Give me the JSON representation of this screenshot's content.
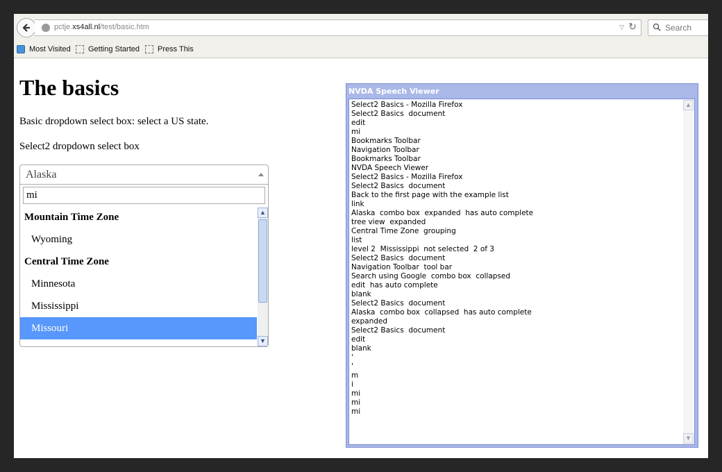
{
  "browser": {
    "url_prefix": "pctje.",
    "url_domain": "xs4all.nl",
    "url_path": "/test/basic.htm",
    "search_placeholder": "Search",
    "bookmarks": [
      "Most Visited",
      "Getting Started",
      "Press This"
    ]
  },
  "page": {
    "title": "The basics",
    "para1": "Basic dropdown select box: select a US state.",
    "para2": "Select2 dropdown select box"
  },
  "select2": {
    "selected_value": "Alaska",
    "search_value": "mi",
    "groups": [
      {
        "label": "Mountain Time Zone",
        "options": [
          "Wyoming"
        ]
      },
      {
        "label": "Central Time Zone",
        "options": [
          "Minnesota",
          "Mississippi",
          "Missouri"
        ]
      }
    ],
    "highlighted_option": "Missouri",
    "highlight_color": "#5897fb"
  },
  "nvda": {
    "title": "NVDA Speech Viewer",
    "lines": [
      "Select2 Basics - Mozilla Firefox",
      "Select2 Basics  document",
      "edit",
      "mi",
      "Bookmarks Toolbar",
      "Navigation Toolbar",
      "Bookmarks Toolbar",
      "NVDA Speech Viewer",
      "Select2 Basics - Mozilla Firefox",
      "Select2 Basics  document",
      "Back to the first page with the example list",
      "link",
      "Alaska  combo box  expanded  has auto complete",
      "tree view  expanded",
      "Central Time Zone  grouping",
      "list",
      "level 2  Mississippi  not selected  2 of 3",
      "Select2 Basics  document",
      "Navigation Toolbar  tool bar",
      "Search using Google  combo box  collapsed",
      "edit  has auto complete",
      "blank",
      "Select2 Basics  document",
      "Alaska  combo box  collapsed  has auto complete",
      "expanded",
      "Select2 Basics  document",
      "edit",
      "blank",
      "'",
      "'",
      "m",
      "i",
      "mi",
      "mi",
      "mi"
    ]
  }
}
